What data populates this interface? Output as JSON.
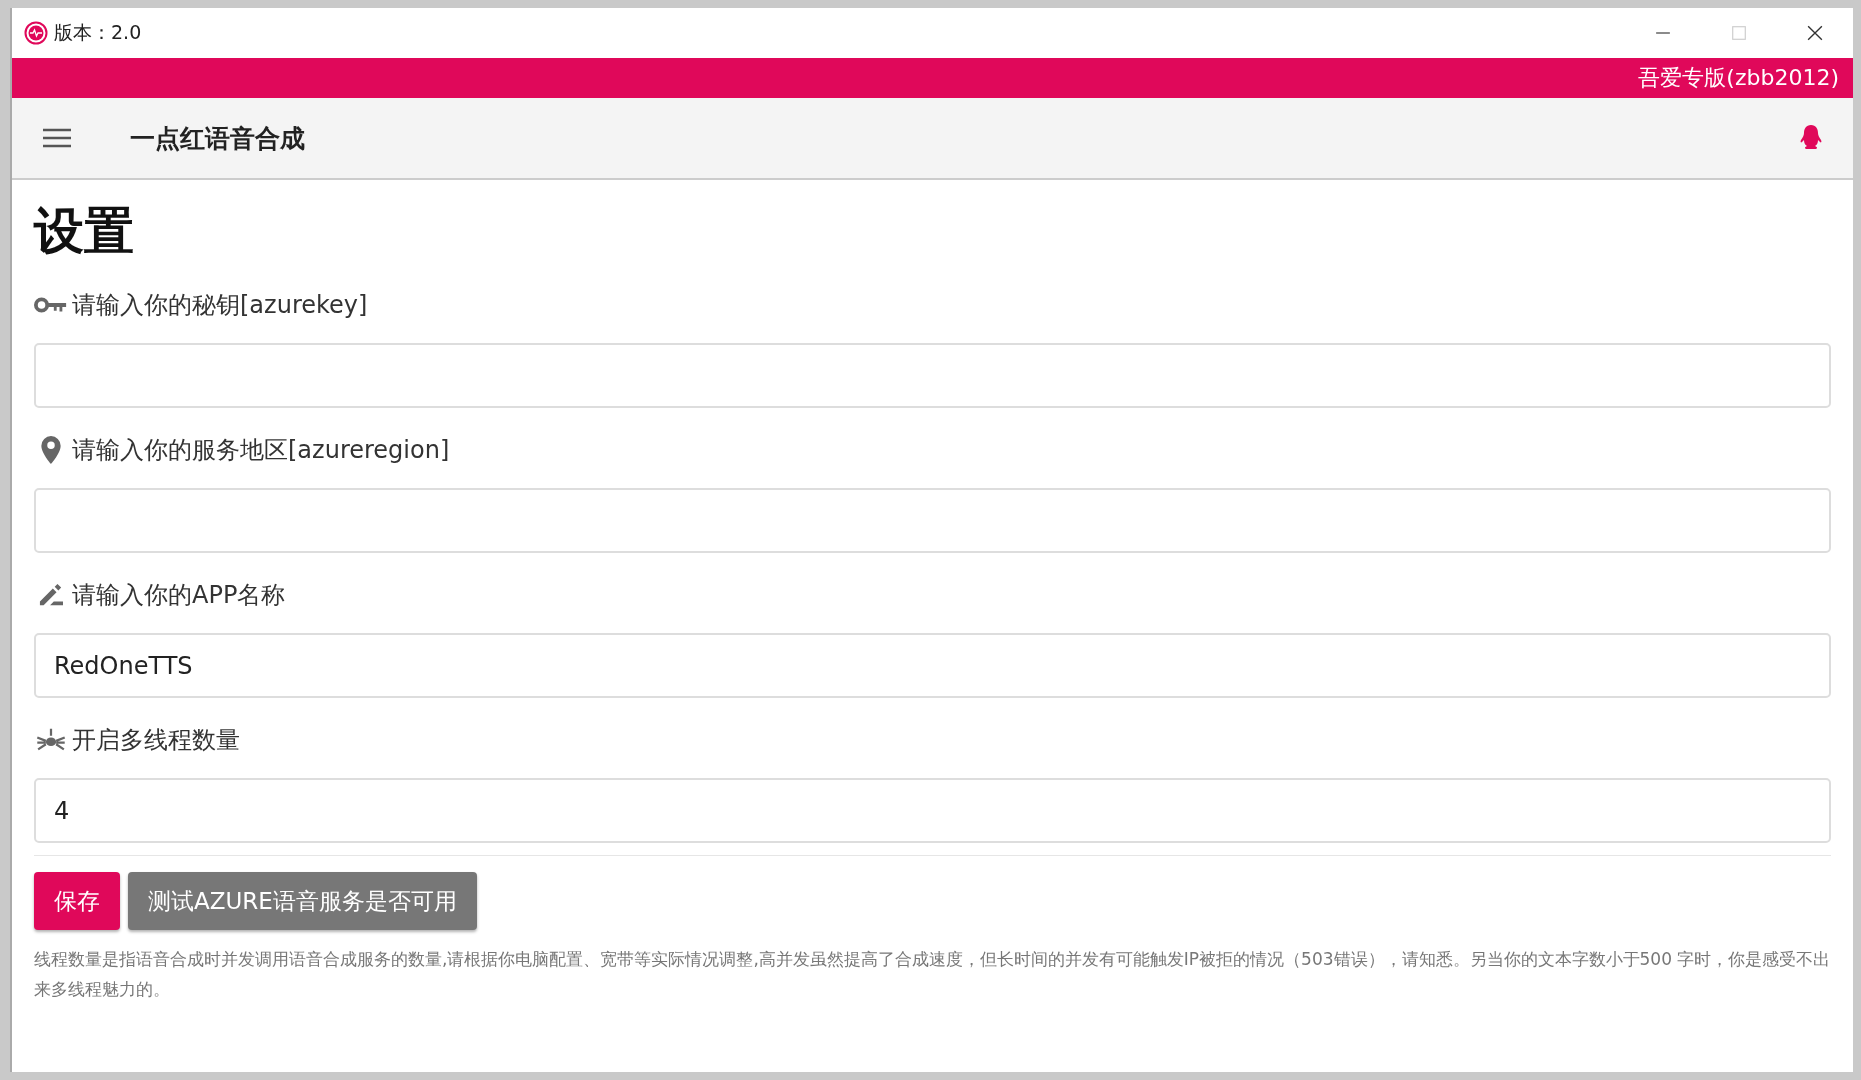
{
  "window": {
    "title": "版本：2.0"
  },
  "banner": {
    "text": "吾爱专版(zbb2012)"
  },
  "toolbar": {
    "title": "一点红语音合成"
  },
  "page": {
    "heading": "设置"
  },
  "fields": [
    {
      "kind": "key",
      "label": "请输入你的秘钥[azurekey]"
    },
    {
      "kind": "location",
      "label": "请输入你的服务地区[azureregion]"
    },
    {
      "kind": "edit",
      "label": "请输入你的APP名称",
      "value": "RedOneTTS"
    },
    {
      "kind": "bug",
      "label": "开启多线程数量",
      "value": "4"
    }
  ],
  "buttons": [
    {
      "kind": "primary",
      "label": "保存"
    },
    {
      "kind": "secondary",
      "label": "测试AZURE语音服务是否可用"
    }
  ],
  "note": "线程数量是指语音合成时并发调用语音合成服务的数量,请根据你电脑配置、宽带等实际情况调整,高并发虽然提高了合成速度，但长时间的并发有可能触发IP被拒的情况（503错误），请知悉。另当你的文本字数小于500 字时，你是感受不出来多线程魅力的。"
}
